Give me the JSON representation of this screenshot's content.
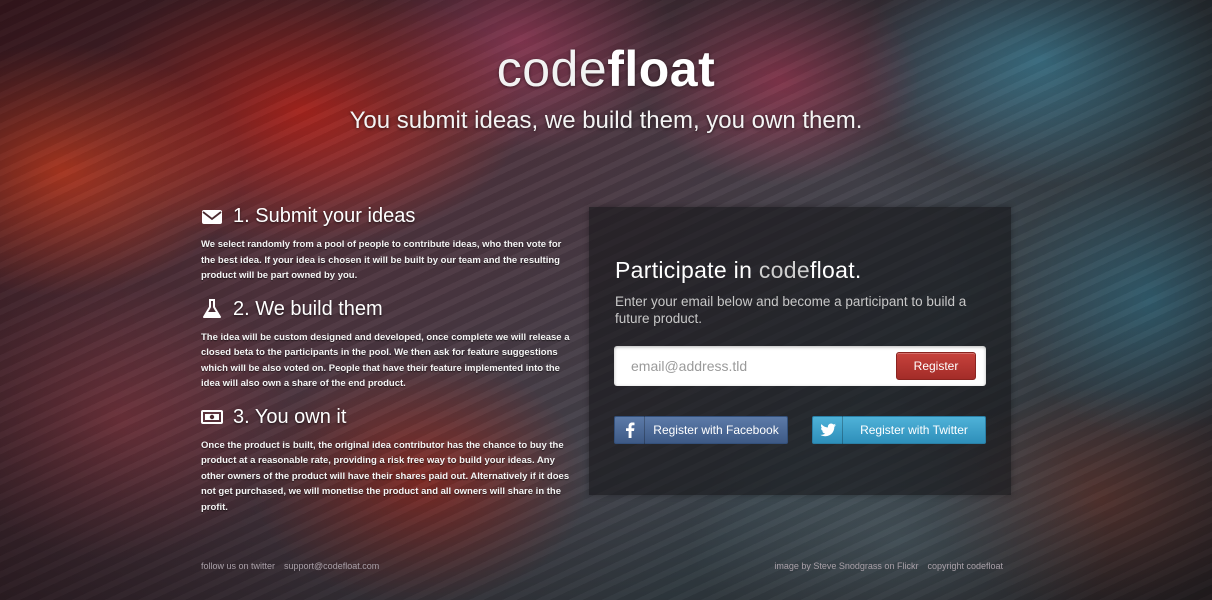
{
  "brand": {
    "name_light": "code",
    "name_bold": "float"
  },
  "tagline": "You submit ideas, we build them, you own them.",
  "steps": [
    {
      "icon": "envelope-icon",
      "title": "1. Submit your ideas",
      "text": "We select randomly from a pool of people to contribute ideas, who then vote for the best idea. If your idea is chosen it will be built by our team and the resulting product will be part owned by you."
    },
    {
      "icon": "flask-icon",
      "title": "2. We build them",
      "text": "The idea will be custom designed and developed, once complete we will release a closed beta to the participants in the pool. We then ask for feature suggestions which will be also voted on. People that have their feature implemented into the idea will also own a share of the end product."
    },
    {
      "icon": "money-icon",
      "title": "3. You own it",
      "text": "Once the product is built, the original idea contributor has the chance to buy the product at a reasonable rate, providing a risk free way to build your ideas. Any other owners of the product will have their shares paid out. Alternatively if it does not get purchased, we will monetise the product and all owners will share in the profit."
    }
  ],
  "panel": {
    "title_prefix": "Participate in ",
    "title_light": "code",
    "title_bold": "float.",
    "description": "Enter your email below and become a participant to build a future product.",
    "email_placeholder": "email@address.tld",
    "register_label": "Register",
    "facebook_label": "Register with Facebook",
    "twitter_label": "Register with Twitter"
  },
  "footer": {
    "follow": "follow us on twitter",
    "support": "support@codefloat.com",
    "image_credit": "image by Steve Snodgrass on Flickr",
    "copyright": "copyright codefloat"
  },
  "colors": {
    "register": "#b3352f",
    "facebook": "#4a6695",
    "twitter": "#3a9fc8"
  }
}
